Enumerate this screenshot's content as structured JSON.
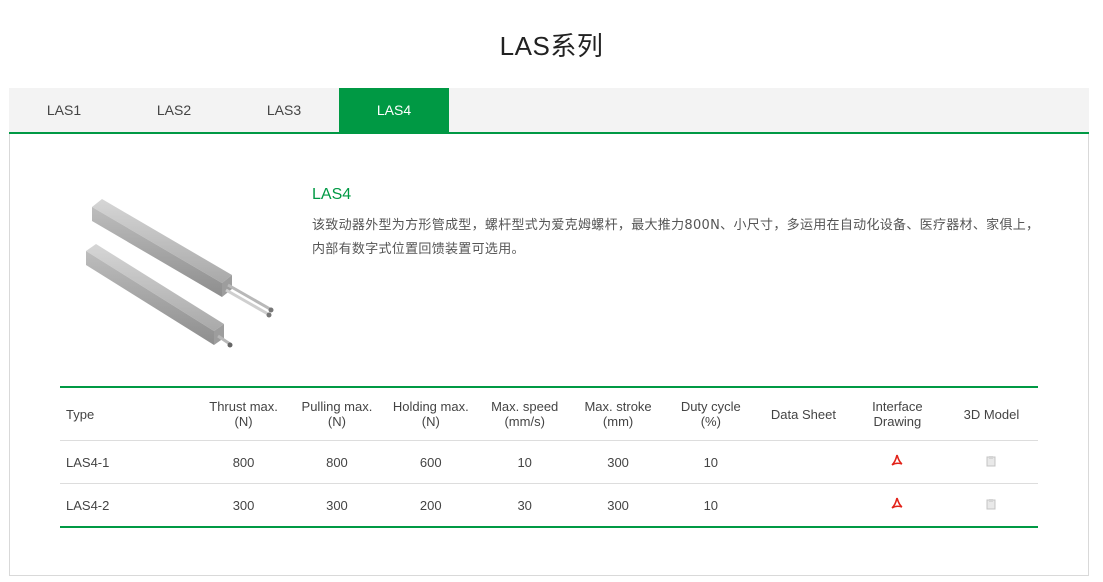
{
  "header": {
    "title": "LAS系列"
  },
  "tabs": [
    {
      "label": "LAS1",
      "active": false
    },
    {
      "label": "LAS2",
      "active": false
    },
    {
      "label": "LAS3",
      "active": false
    },
    {
      "label": "LAS4",
      "active": true
    }
  ],
  "colors": {
    "accent": "#009944",
    "pdf": "#e2231a"
  },
  "product": {
    "name": "LAS4",
    "description": "该致动器外型为方形管成型，螺杆型式为爱克姆螺杆，最大推力800N、小尺寸，多运用在自动化设备、医疗器材、家俱上，内部有数字式位置回馈装置可选用。"
  },
  "table": {
    "headers": {
      "type": "Type",
      "thrust_1": "Thrust max.",
      "thrust_2": "(N)",
      "pulling_1": "Pulling max.",
      "pulling_2": "(N)",
      "holding_1": "Holding max.",
      "holding_2": "(N)",
      "speed_1": "Max. speed",
      "speed_2": "(mm/s)",
      "stroke_1": "Max. stroke",
      "stroke_2": "(mm)",
      "duty_1": "Duty cycle",
      "duty_2": "(%)",
      "datasheet": "Data Sheet",
      "interface_1": "Interface",
      "interface_2": "Drawing",
      "model3d": "3D Model"
    },
    "rows": [
      {
        "type": "LAS4-1",
        "thrust": "800",
        "pulling": "800",
        "holding": "600",
        "speed": "10",
        "stroke": "300",
        "duty": "10",
        "interface_icon": "pdf-icon",
        "model_icon": "3d-model-icon"
      },
      {
        "type": "LAS4-2",
        "thrust": "300",
        "pulling": "300",
        "holding": "200",
        "speed": "30",
        "stroke": "300",
        "duty": "10",
        "interface_icon": "pdf-icon",
        "model_icon": "3d-model-icon"
      }
    ]
  }
}
